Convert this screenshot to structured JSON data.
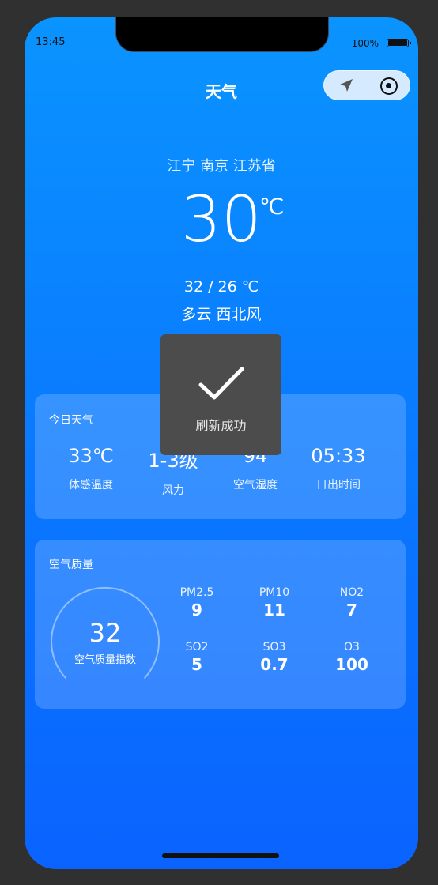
{
  "status_bar": {
    "time": "13:45",
    "battery": "100%"
  },
  "header": {
    "title": "天气"
  },
  "capsule": {
    "location_icon": "navigation-arrow-icon",
    "target_icon": "target-icon"
  },
  "current": {
    "location": "江宁 南京 江苏省",
    "temperature": "30",
    "unit": "℃",
    "range": "32 / 26 ℃",
    "description": "多云 西北风"
  },
  "today": {
    "title": "今日天气",
    "items": [
      {
        "value": "33℃",
        "label": "体感温度"
      },
      {
        "value": "1-3级",
        "label": "风力"
      },
      {
        "value": "94",
        "label": "空气湿度"
      },
      {
        "value": "05:33",
        "label": "日出时间"
      }
    ]
  },
  "air": {
    "title": "空气质量",
    "aqi": "32",
    "aqi_label": "空气质量指数",
    "pollutants": [
      {
        "name": "PM2.5",
        "value": "9"
      },
      {
        "name": "PM10",
        "value": "11"
      },
      {
        "name": "NO2",
        "value": "7"
      },
      {
        "name": "SO2",
        "value": "5"
      },
      {
        "name": "SO3",
        "value": "0.7"
      },
      {
        "name": "O3",
        "value": "100"
      }
    ]
  },
  "toast": {
    "text": "刷新成功",
    "icon": "checkmark-icon"
  }
}
